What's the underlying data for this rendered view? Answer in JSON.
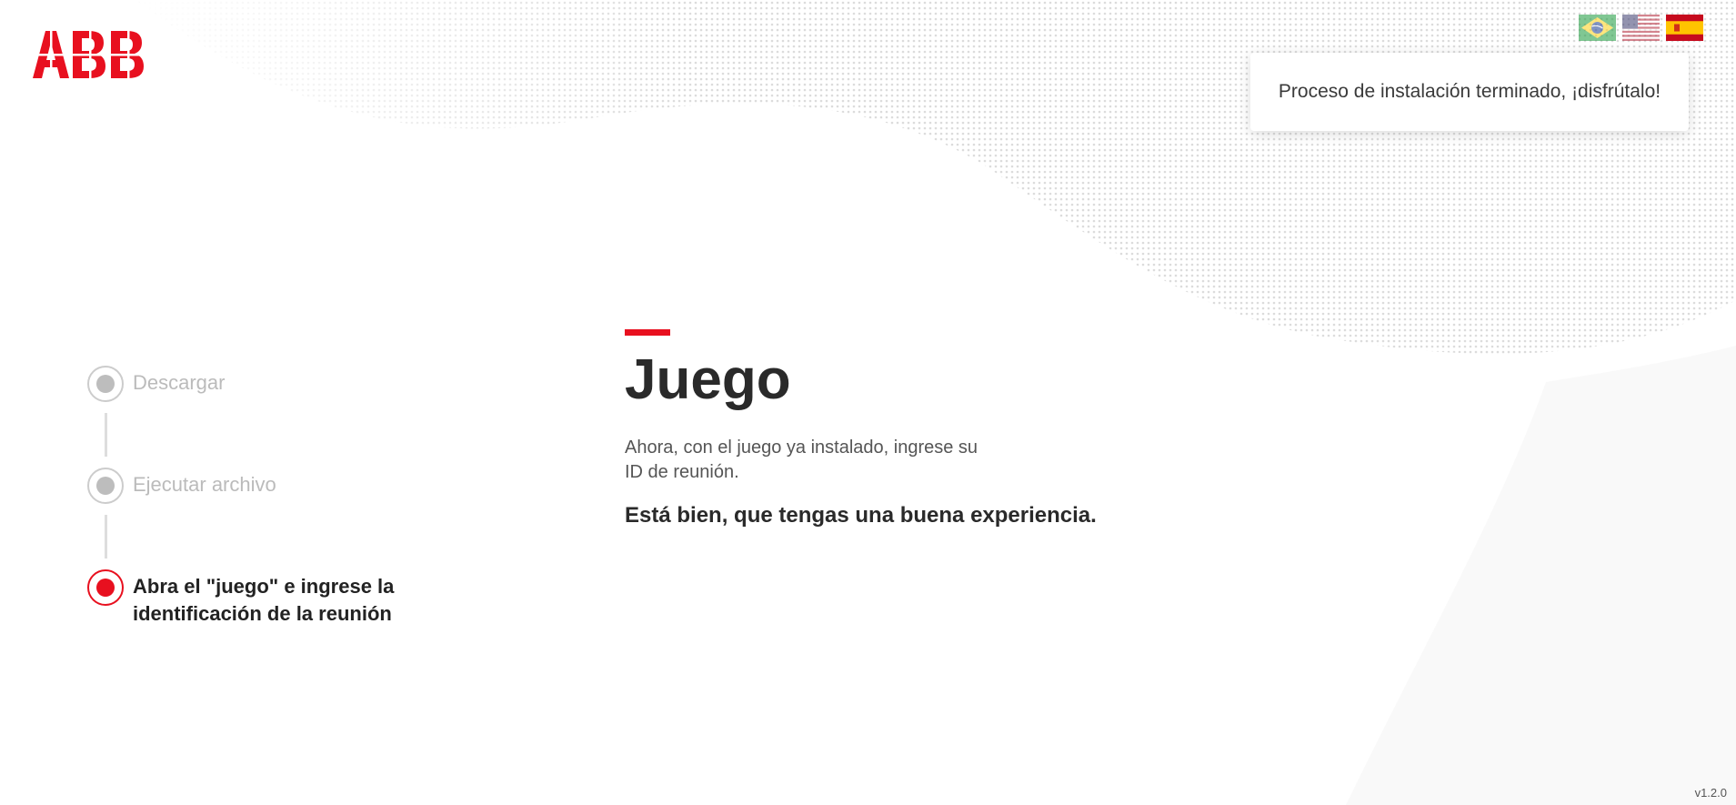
{
  "brand": {
    "logo_text": "ABB",
    "accent_color": "#e8101f"
  },
  "languages": [
    {
      "code": "pt-BR",
      "icon": "brazil-flag-icon",
      "active": false
    },
    {
      "code": "en-US",
      "icon": "usa-flag-icon",
      "active": false
    },
    {
      "code": "es",
      "icon": "spain-flag-icon",
      "active": true
    }
  ],
  "toast": {
    "message": "Proceso de instalación terminado, ¡disfrútalo!"
  },
  "steps": [
    {
      "label": "Descargar",
      "state": "done"
    },
    {
      "label": "Ejecutar archivo",
      "state": "done"
    },
    {
      "label": "Abra el \"juego\" e ingrese la identificación de la reunión",
      "state": "active"
    }
  ],
  "main": {
    "title": "Juego",
    "description": "Ahora, con el juego ya instalado, ingrese su ID de reunión.",
    "subtitle": "Está bien, que tengas una buena experiencia."
  },
  "footer": {
    "version": "v1.2.0"
  }
}
